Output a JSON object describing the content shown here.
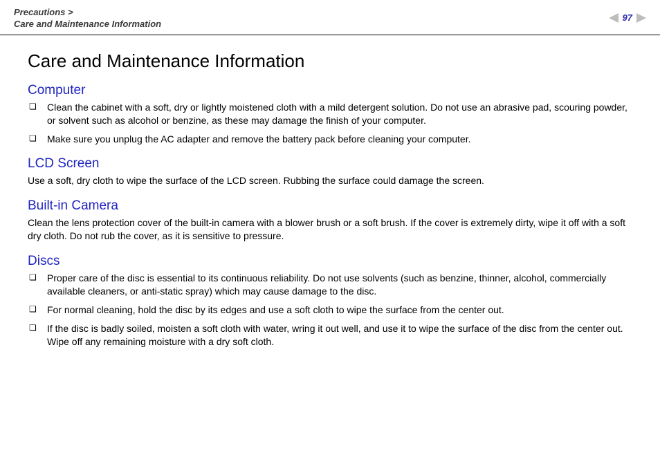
{
  "header": {
    "breadcrumb_parent": "Precautions >",
    "breadcrumb_current": "Care and Maintenance Information",
    "page_number": "97"
  },
  "main": {
    "title": "Care and Maintenance Information",
    "sections": [
      {
        "heading": "Computer",
        "bullets": [
          "Clean the cabinet with a soft, dry or lightly moistened cloth with a mild detergent solution. Do not use an abrasive pad, scouring powder, or solvent such as alcohol or benzine, as these may damage the finish of your computer.",
          "Make sure you unplug the AC adapter and remove the battery pack before cleaning your computer."
        ]
      },
      {
        "heading": "LCD Screen",
        "paragraph": "Use a soft, dry cloth to wipe the surface of the LCD screen. Rubbing the surface could damage the screen."
      },
      {
        "heading": "Built-in Camera",
        "paragraph": "Clean the lens protection cover of the built-in camera with a blower brush or a soft brush. If the cover is extremely dirty, wipe it off with a soft dry cloth. Do not rub the cover, as it is sensitive to pressure."
      },
      {
        "heading": "Discs",
        "bullets": [
          "Proper care of the disc is essential to its continuous reliability. Do not use solvents (such as benzine, thinner, alcohol, commercially available cleaners, or anti-static spray) which may cause damage to the disc.",
          "For normal cleaning, hold the disc by its edges and use a soft cloth to wipe the surface from the center out.",
          "If the disc is badly soiled, moisten a soft cloth with water, wring it out well, and use it to wipe the surface of the disc from the center out. Wipe off any remaining moisture with a dry soft cloth."
        ]
      }
    ]
  }
}
